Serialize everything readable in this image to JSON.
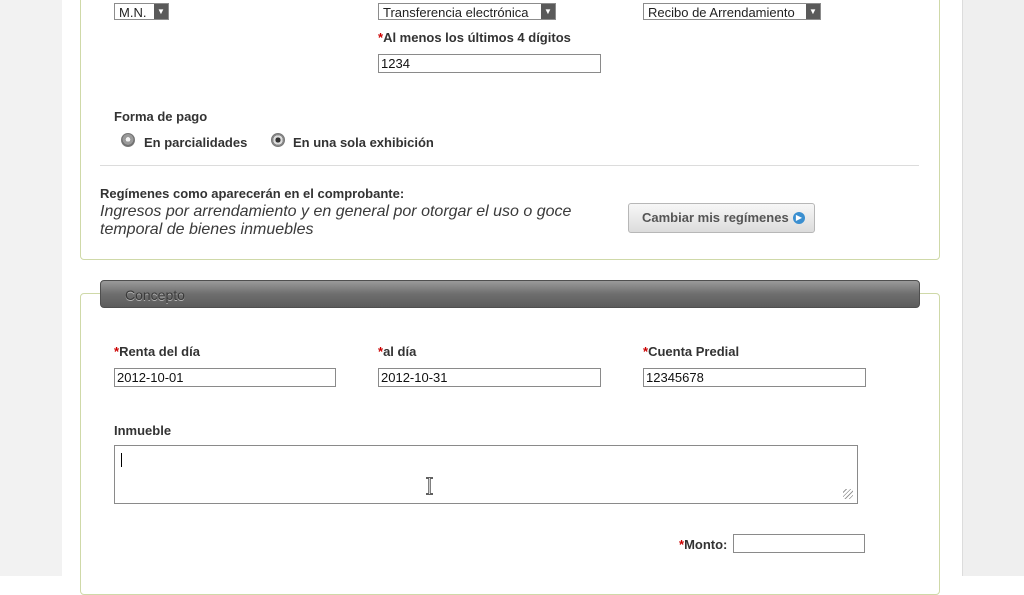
{
  "payment": {
    "currency_value": "M.N.",
    "method_value": "Transferencia electrónica",
    "document_value": "Recibo de Arrendamiento",
    "digits_label": "Al menos los últimos 4 dígitos",
    "digits_value": "1234"
  },
  "forma_pago": {
    "label": "Forma de pago",
    "options": [
      {
        "label": "En parcialidades",
        "selected": false
      },
      {
        "label": "En una sola exhibición",
        "selected": true
      }
    ]
  },
  "regimenes": {
    "label": "Regímenes como aparecerán en el comprobante:",
    "text": "Ingresos por arrendamiento y en general por otorgar el uso o goce temporal de bienes inmuebles",
    "button_label": "Cambiar mis regímenes"
  },
  "concepto": {
    "title": "Concepto",
    "renta_label": "Renta del día",
    "renta_value": "2012-10-01",
    "al_dia_label": "al día",
    "al_dia_value": "2012-10-31",
    "cuenta_label": "Cuenta Predial",
    "cuenta_value": "12345678",
    "inmueble_label": "Inmueble",
    "inmueble_value": "",
    "monto_label": "Monto",
    "monto_value": ""
  },
  "required_marker": "*",
  "colors": {
    "required": "#cc0000",
    "panel_border": "#cfd9a8",
    "header_bar": "#6e6e6e",
    "info_icon": "#3b8fd0"
  },
  "icons": {
    "select_arrow": "chevron-down-icon",
    "info": "arrow-right-circle-icon",
    "cursor": "text-cursor-icon"
  }
}
